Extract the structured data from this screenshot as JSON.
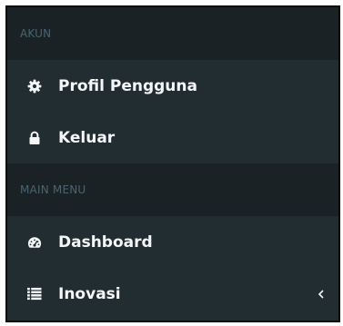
{
  "sidebar": {
    "sections": [
      {
        "header": "AKUN",
        "items": [
          {
            "label": "Profil Pengguna",
            "icon": "gear-icon"
          },
          {
            "label": "Keluar",
            "icon": "lock-icon"
          }
        ]
      },
      {
        "header": "MAIN MENU",
        "items": [
          {
            "label": "Dashboard",
            "icon": "dashboard-icon"
          },
          {
            "label": "Inovasi",
            "icon": "list-icon",
            "expand_icon": "chevron-left-icon"
          }
        ]
      }
    ]
  },
  "colors": {
    "sidebar_bg": "#222d32",
    "header_bg": "#1a2226",
    "header_text": "#4b646f",
    "item_text": "#f4f6f7"
  }
}
